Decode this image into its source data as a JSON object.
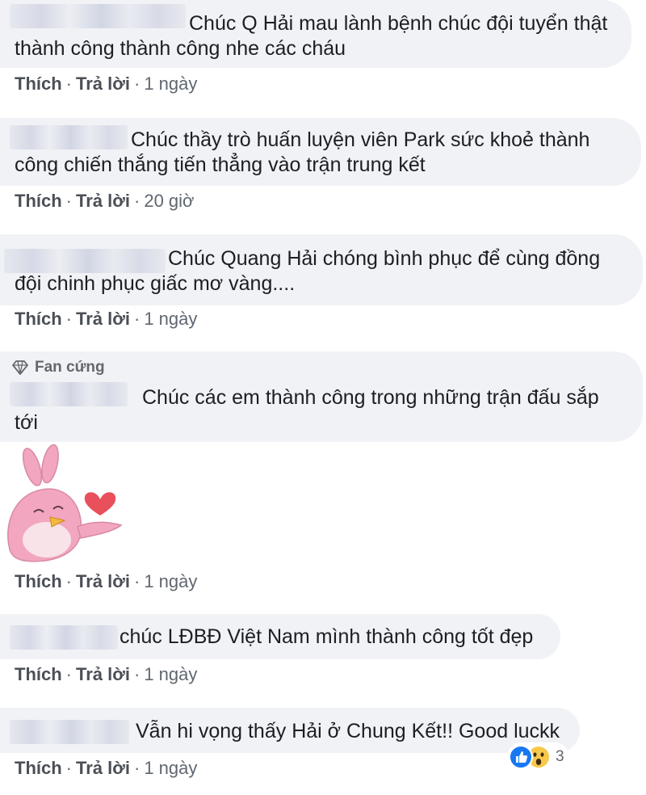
{
  "comments": [
    {
      "text_line1": "Chúc Q Hải mau lành bệnh chúc đội tuyển thật",
      "text_line2": "thành công thành công nhe các cháu",
      "like": "Thích",
      "reply": "Trả lời",
      "time": "1 ngày"
    },
    {
      "text_line1": "Chúc thầy trò huấn luyện viên Park sức khoẻ thành",
      "text_line2": "công chiến thắng tiến thẳng vào trận trung kết",
      "like": "Thích",
      "reply": "Trả lời",
      "time": "20 giờ"
    },
    {
      "text_line1": "Chúc Quang Hải chóng bình phục để cùng đồng",
      "text_line2": "đội chinh phục giấc mơ vàng....",
      "like": "Thích",
      "reply": "Trả lời",
      "time": "1 ngày"
    },
    {
      "badge": "Fan cứng",
      "badge_icon": "diamond-icon",
      "text_line1": "Chúc các em thành công trong những trận đấu sắp",
      "text_line2": "tới",
      "sticker": "pink-bird-blowing-kiss-sticker",
      "like": "Thích",
      "reply": "Trả lời",
      "time": "1 ngày"
    },
    {
      "text_line1": "chúc LĐBĐ Việt Nam mình thành công tốt đẹp",
      "like": "Thích",
      "reply": "Trả lời",
      "time": "1 ngày"
    },
    {
      "text_line1": "Vẫn hi vọng thấy Hải ở Chung Kết!! Good luckk",
      "like": "Thích",
      "reply": "Trả lời",
      "time": "1 ngày",
      "reactions": {
        "icons": [
          "like-reaction-icon",
          "wow-reaction-icon"
        ],
        "count": "3"
      }
    }
  ],
  "separator": "·",
  "colors": {
    "bubble": "#f0f2f5",
    "text": "#1c1e21",
    "meta": "#606770",
    "like_blue": "#1877f2",
    "wow_yellow": "#f7c84a",
    "sticker_pink": "#f3a6bf",
    "heart_red": "#e8505b"
  }
}
